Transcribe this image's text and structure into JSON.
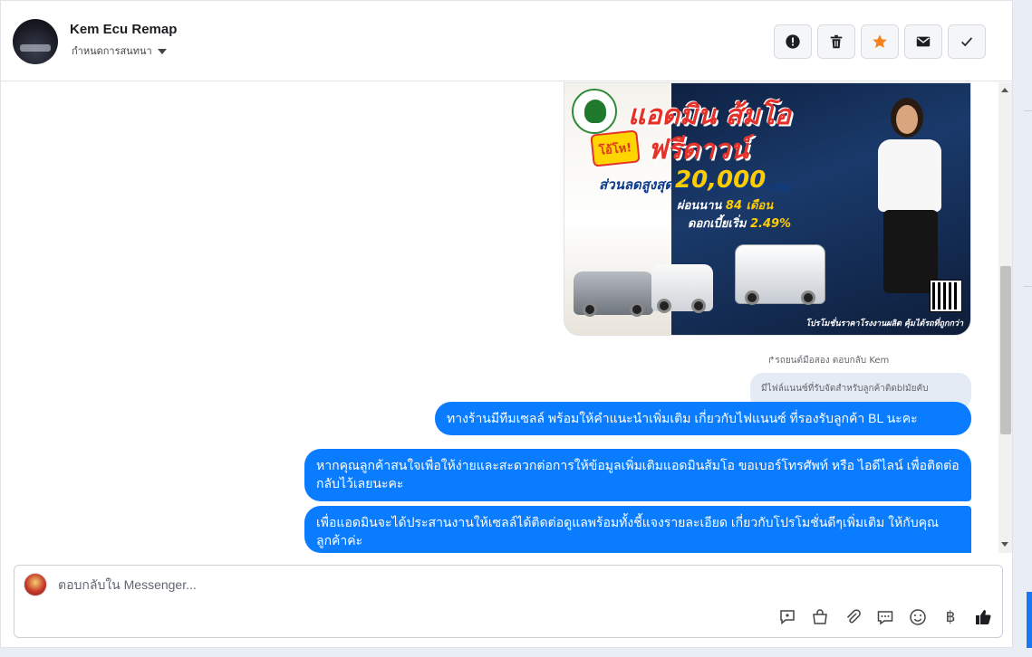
{
  "header": {
    "contact_name": "Kem Ecu Remap",
    "assign_label": "กำหนดการสนทนา",
    "tools": [
      {
        "name": "report-icon",
        "label": "!"
      },
      {
        "name": "trash-icon",
        "label": ""
      },
      {
        "name": "star-icon",
        "label": ""
      },
      {
        "name": "mail-icon",
        "label": ""
      },
      {
        "name": "check-icon",
        "label": ""
      }
    ],
    "accent_star": "#f5821f"
  },
  "ad": {
    "line1": "แอดมิน ส้มโอ",
    "line2": "ฟรีดาวน์",
    "burst": "โอ้โห!",
    "discount_label": "ส่วนลดสูงสุด",
    "discount_amount": "20,000",
    "baht": "บาท",
    "installment_prefix": "ผ่อนนาน ",
    "installment_value": "84 เดือน",
    "rate_prefix": "ดอกเบี้ยเริ่ม ",
    "rate_value": "2.49%",
    "footer": "โปรโมชั่นราคาโรงงานผลิต คุ้มได้รถที่ถูกกว่า"
  },
  "thread": {
    "reply_line": "รถยนต์มือสอง ตอบกลับ Kem",
    "quoted_text": "มีไฟล์แนนซ์ที่รับจัดสำหรับลูกค้าติดblมัยคับ",
    "messages": [
      "ทางร้านมีทีมเซลล์ พร้อมให้คำแนะนำเพิ่มเติม เกี่ยวกับไฟแนนซ์ ที่รองรับลูกค้า BL นะคะ",
      "หากคุณลูกค้าสนใจเพื่อให้ง่ายและสะดวกต่อการให้ข้อมูลเพิ่มเติมแอดมินส้มโอ ขอเบอร์โทรศัพท์ หรือ ไอดีไลน์ เพื่อติดต่อกลับไว้เลยนะคะ",
      "เพื่อแอดมินจะได้ประสานงานให้เซลล์ได้ติดต่อดูแลพร้อมทั้งชี้แจงรายละเอียด เกี่ยวกับโปรโมชั่นดีๆเพิ่มเติม ให้กับคุณลูกค้าค่ะ"
    ],
    "bubble_color": "#0a7cff"
  },
  "composer": {
    "placeholder": "ตอบกลับใน Messenger...",
    "baht_symbol": "฿",
    "icons": [
      "saved-reply-icon",
      "shop-bag-icon",
      "attach-icon",
      "chat-bubble-icon",
      "emoji-icon",
      "baht-icon",
      "like-icon"
    ]
  }
}
